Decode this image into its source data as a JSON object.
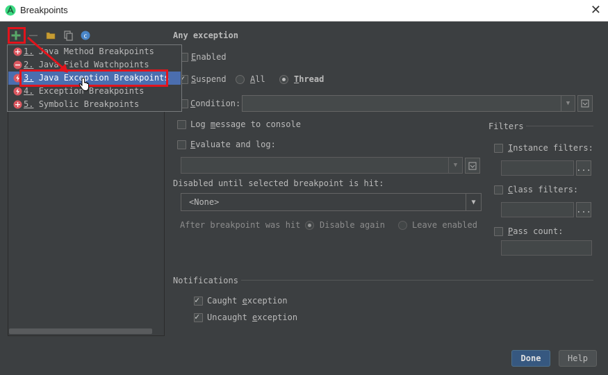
{
  "window": {
    "title": "Breakpoints"
  },
  "colors": {
    "accent": "#4b6eaf",
    "annotation": "#e2141c",
    "add_green": "#59a869"
  },
  "popup": {
    "items": [
      {
        "num": "1.",
        "label": "Java Method Breakpoints",
        "icon": "method-breakpoint-icon"
      },
      {
        "num": "2.",
        "label": "Java Field Watchpoints",
        "icon": "field-watchpoint-icon"
      },
      {
        "num": "3.",
        "label": "Java Exception Breakpoints",
        "icon": "exception-breakpoint-icon",
        "selected": true
      },
      {
        "num": "4.",
        "label": "Exception Breakpoints",
        "icon": "exception-breakpoint-icon"
      },
      {
        "num": "5.",
        "label": "Symbolic Breakpoints",
        "icon": "symbolic-breakpoint-icon"
      }
    ]
  },
  "details": {
    "heading": "Any exception",
    "enabled": {
      "label_u": "E",
      "label_rest": "nabled",
      "checked": false
    },
    "suspend": {
      "label_u": "S",
      "label_rest": "uspend",
      "checked": true
    },
    "all": {
      "label_u": "A",
      "label_rest": "ll"
    },
    "thread": {
      "label_u": "T",
      "label_rest": "hread"
    },
    "condition": {
      "label_u": "C",
      "label_rest": "ondition:"
    },
    "log_message": {
      "label_pre": "Log ",
      "label_u": "m",
      "label_rest": "essage to console"
    },
    "evaluate": {
      "label_u": "E",
      "label_rest": "valuate and log:"
    },
    "disabled_until": "Disabled until selected breakpoint is hit:",
    "none_value": "<None>",
    "after_hit": "After breakpoint was hit",
    "disable_again": "Disable again",
    "leave_enabled": "Leave enabled",
    "notifications": "Notifications",
    "caught": {
      "label_pre": "Caught ",
      "label_u": "e",
      "label_rest": "xception"
    },
    "uncaught": {
      "label_pre": "Uncaught ",
      "label_u": "e",
      "label_rest": "xception"
    }
  },
  "filters": {
    "title": "Filters",
    "instance": {
      "label_u": "I",
      "label_rest": "nstance filters:"
    },
    "class": {
      "label_u": "C",
      "label_rest": "lass filters:"
    },
    "pass": {
      "label_u": "P",
      "label_rest": "ass count:"
    },
    "browse": "..."
  },
  "buttons": {
    "done": "Done",
    "help": "Help"
  }
}
